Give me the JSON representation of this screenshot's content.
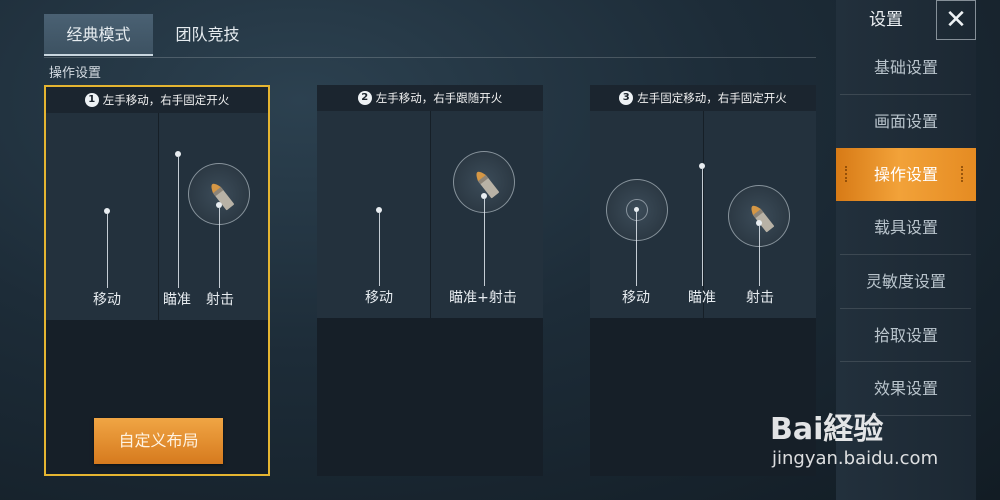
{
  "tabs": [
    {
      "label": "经典模式",
      "active": true
    },
    {
      "label": "团队竞技",
      "active": false
    }
  ],
  "section_title": "操作设置",
  "cards": [
    {
      "number": "1",
      "title": "左手移动，右手固定开火",
      "selected": true,
      "labels": {
        "move": "移动",
        "aim": "瞄准",
        "shoot": "射击"
      },
      "custom_button": "自定义布局"
    },
    {
      "number": "2",
      "title": "左手移动，右手跟随开火",
      "selected": false,
      "labels": {
        "move": "移动",
        "aim_shoot": "瞄准+射击"
      }
    },
    {
      "number": "3",
      "title": "左手固定移动，右手固定开火",
      "selected": false,
      "labels": {
        "move": "移动",
        "aim": "瞄准",
        "shoot": "射击"
      }
    }
  ],
  "sidebar": {
    "title": "设置",
    "close_glyph": "✕",
    "items": [
      {
        "label": "基础设置",
        "active": false
      },
      {
        "label": "画面设置",
        "active": false
      },
      {
        "label": "操作设置",
        "active": true
      },
      {
        "label": "载具设置",
        "active": false
      },
      {
        "label": "灵敏度设置",
        "active": false
      },
      {
        "label": "拾取设置",
        "active": false
      },
      {
        "label": "效果设置",
        "active": false
      }
    ]
  },
  "watermark": {
    "brand": "Bai経验",
    "url": "jingyan.baidu.com"
  },
  "colors": {
    "accent": "#f0a544",
    "selected_border": "#e5b531",
    "panel": "#23313d"
  }
}
